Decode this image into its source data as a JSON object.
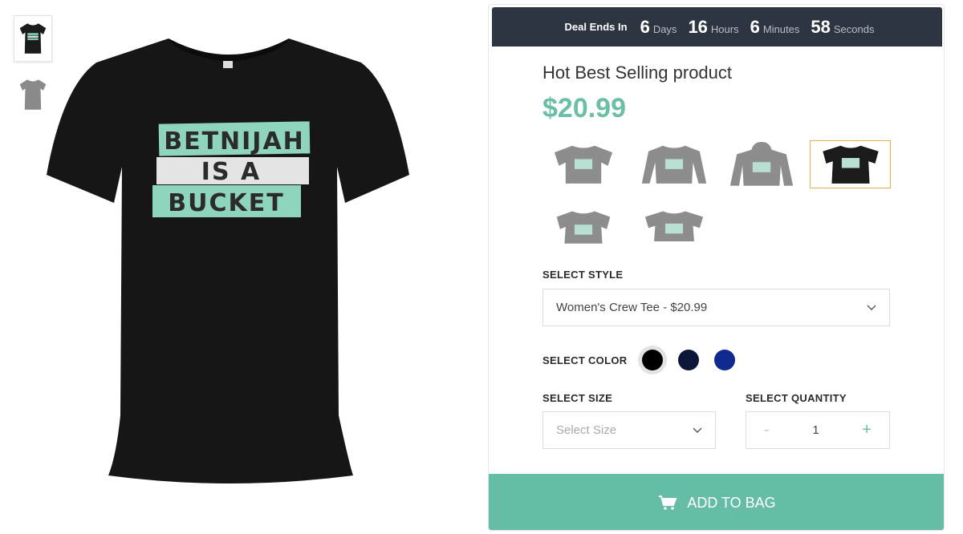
{
  "countdown": {
    "label": "Deal Ends In",
    "days": "6",
    "days_label": "Days",
    "hours": "16",
    "hours_label": "Hours",
    "minutes": "6",
    "minutes_label": "Minutes",
    "seconds": "58",
    "seconds_label": "Seconds"
  },
  "product": {
    "title": "Hot Best Selling product",
    "price": "$20.99",
    "design_text": [
      "BETNIJAH",
      "IS A",
      "BUCKET"
    ]
  },
  "thumbnails": [
    {
      "name": "black-tee",
      "color": "#1b1b1b"
    },
    {
      "name": "gray-tee",
      "color": "#8a8a8a"
    }
  ],
  "style_options": [
    {
      "name": "unisex-tee",
      "color": "#8d8d8d"
    },
    {
      "name": "long-sleeve",
      "color": "#8d8d8d"
    },
    {
      "name": "hoodie",
      "color": "#8d8d8d"
    },
    {
      "name": "womens-crew-tee",
      "color": "#1b1b1b",
      "selected": true
    },
    {
      "name": "crop-tee",
      "color": "#8d8d8d"
    },
    {
      "name": "crop-top",
      "color": "#8d8d8d"
    }
  ],
  "select_style": {
    "label": "SELECT STYLE",
    "value": "Women's Crew Tee - $20.99"
  },
  "select_color": {
    "label": "SELECT COLOR",
    "options": [
      {
        "name": "black",
        "hex": "#000000",
        "selected": true
      },
      {
        "name": "navy",
        "hex": "#0c1638"
      },
      {
        "name": "royal-blue",
        "hex": "#10298f"
      }
    ]
  },
  "select_size": {
    "label": "SELECT SIZE",
    "placeholder": "Select Size"
  },
  "select_quantity": {
    "label": "SELECT QUANTITY",
    "minus": "-",
    "value": "1",
    "plus": "+"
  },
  "cta": {
    "label": "ADD TO BAG"
  },
  "colors": {
    "accent": "#66bda5",
    "price": "#6bbfa7",
    "countdown_bg": "#2e3542",
    "selected_border": "#e3b04b"
  }
}
